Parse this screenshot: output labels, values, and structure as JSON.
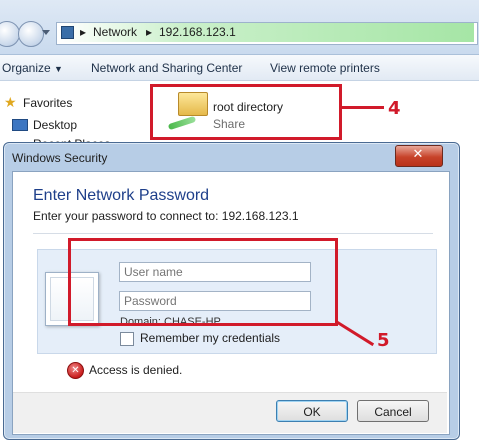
{
  "explorer": {
    "breadcrumb": [
      "Network",
      "192.168.123.1"
    ],
    "commands": {
      "organize": "Organize",
      "network_sharing": "Network and Sharing Center",
      "view_printers": "View remote printers"
    },
    "nav": {
      "favorites": "Favorites",
      "desktop": "Desktop",
      "recent_places": "Recent Places"
    },
    "share": {
      "name": "root directory",
      "type": "Share"
    }
  },
  "callouts": {
    "step4": "4",
    "step5": "5"
  },
  "dialog": {
    "title": "Windows Security",
    "close_symbol": "✕",
    "heading": "Enter Network Password",
    "subtext": "Enter your password to connect to: 192.168.123.1",
    "username_placeholder": "User name",
    "password_placeholder": "Password",
    "domain": "Domain: CHASE-HP",
    "remember": "Remember my credentials",
    "error": "Access is denied.",
    "ok": "OK",
    "cancel": "Cancel"
  },
  "colors": {
    "callout_red": "#d11a2a",
    "heading_blue": "#1e3f8a"
  },
  "icons": [
    "back-arrow-icon",
    "forward-arrow-icon",
    "network-icon",
    "folder-share-icon",
    "star-icon",
    "desktop-icon",
    "error-icon",
    "user-tile-icon"
  ]
}
